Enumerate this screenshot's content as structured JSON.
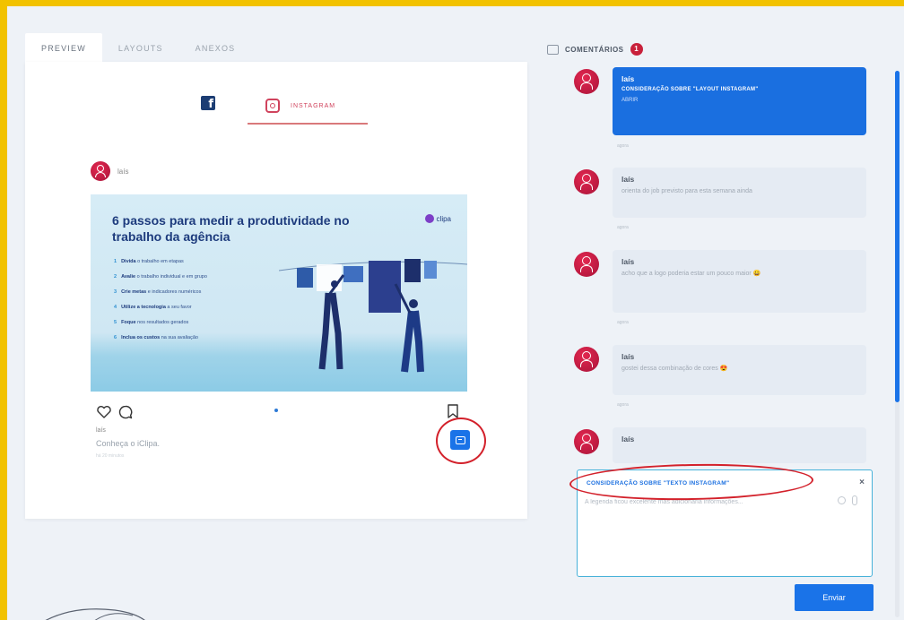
{
  "tabs": [
    {
      "label": "PREVIEW",
      "active": true
    },
    {
      "label": "LAYOUTS",
      "active": false
    },
    {
      "label": "ANEXOS",
      "active": false
    }
  ],
  "networks": {
    "facebook_icon": "facebook-icon",
    "instagram_label": "INSTAGRAM",
    "active": "instagram"
  },
  "post": {
    "user": "laís",
    "image": {
      "title": "6 passos para medir a produtividade no trabalho da agência",
      "brand": "clipa",
      "steps": [
        {
          "n": "1",
          "strong": "Divida",
          "rest": " o trabalho em etapas"
        },
        {
          "n": "2",
          "strong": "Avalie",
          "rest": " o trabalho individual e em grupo"
        },
        {
          "n": "3",
          "strong": "Crie metas",
          "rest": " e indicadores numéricos"
        },
        {
          "n": "4",
          "strong": "Utilize a tecnologia",
          "rest": " a seu favor"
        },
        {
          "n": "5",
          "strong": "Foque",
          "rest": " nos resultados gerados"
        },
        {
          "n": "6",
          "strong": "Inclua os custos",
          "rest": " na sua avaliação"
        }
      ]
    },
    "likes_user": "laís",
    "caption": "Conheça o iClipa.",
    "time": "há 20 minutos"
  },
  "comments_panel": {
    "title": "COMENTÁRIOS",
    "count": "1",
    "comments": [
      {
        "author": "laís",
        "reference": "CONSIDERAÇÃO SOBRE \"LAYOUT INSTAGRAM\"",
        "link": "ABRIR",
        "time": "agora",
        "highlighted": true
      },
      {
        "author": "laís",
        "text": "orienta do job previsto para esta semana ainda",
        "time": "agora"
      },
      {
        "author": "laís",
        "text": "acho que a logo poderia estar um pouco maior 😀",
        "time": "agora"
      },
      {
        "author": "laís",
        "text": "gostei dessa combinação de cores 😍",
        "time": "agora"
      },
      {
        "author": "laís",
        "text": "",
        "time": ""
      }
    ],
    "compose": {
      "reference": "CONSIDERAÇÃO SOBRE \"TEXTO INSTAGRAM\"",
      "placeholder": "A legenda ficou excelente mas adicionaria informações...",
      "close": "×"
    },
    "send_label": "Enviar"
  },
  "colors": {
    "frame": "#f2c200",
    "accent": "#1a73e8",
    "badge": "#c8213b",
    "instagram": "#d0435d",
    "annotation": "#d3212b"
  }
}
